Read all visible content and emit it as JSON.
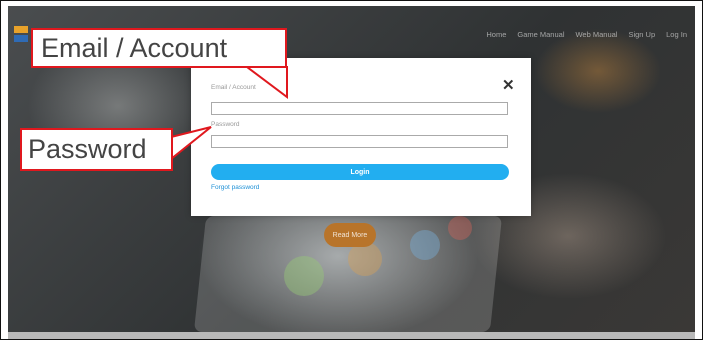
{
  "nav": {
    "items": [
      "Home",
      "Game Manual",
      "Web Manual",
      "Sign Up",
      "Log In"
    ]
  },
  "hero": {
    "read_more": "Read More"
  },
  "login_modal": {
    "close_symbol": "✕",
    "email_label": "Email / Account",
    "email_value": "",
    "password_label": "Password",
    "password_value": "",
    "login_button": "Login",
    "forgot_link": "Forgot password"
  },
  "callouts": {
    "email": "Email / Account",
    "password": "Password"
  },
  "colors": {
    "accent_blue": "#22aef0",
    "callout_red": "#e0181e",
    "link_blue": "#1e90d6"
  },
  "icons": {
    "close": "close-icon",
    "logo": "site-logo"
  }
}
